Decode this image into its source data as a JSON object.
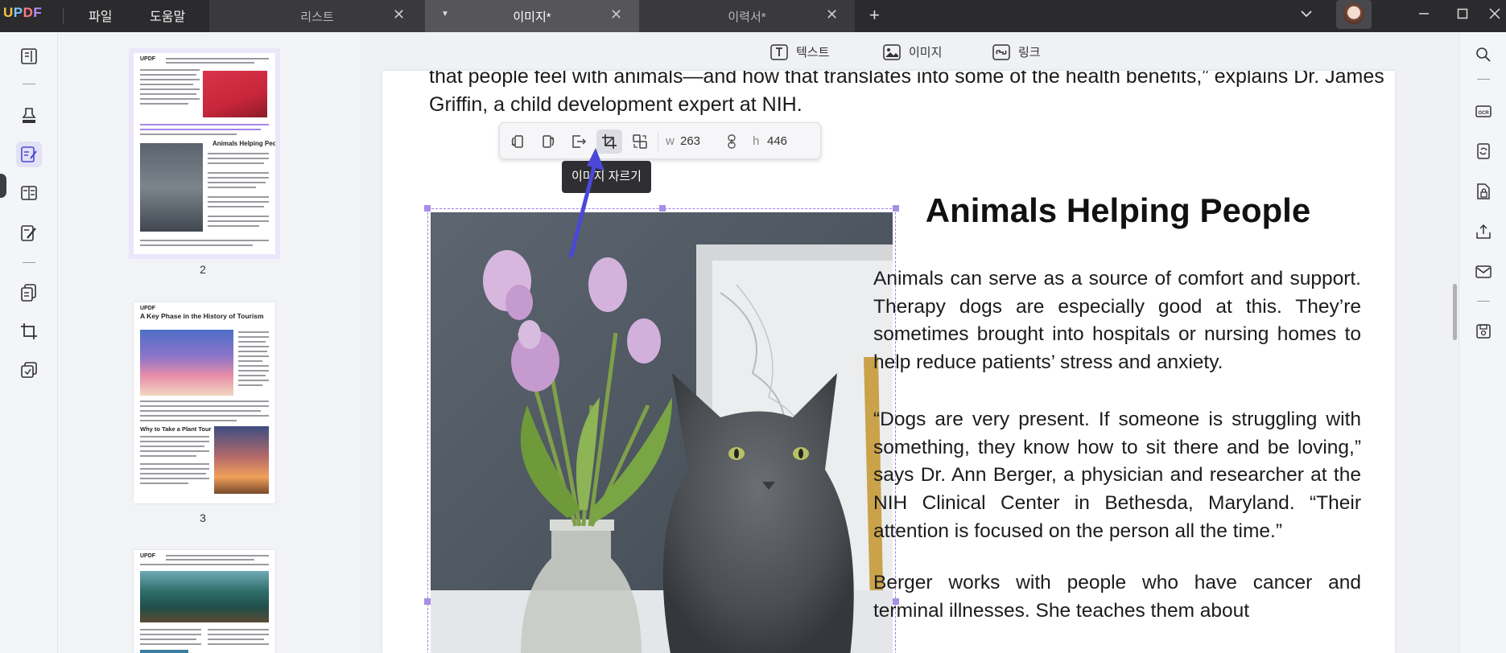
{
  "app": {
    "logo": "UPDF",
    "menu": [
      "파일",
      "도움말"
    ]
  },
  "tabs": [
    {
      "label": "리스트",
      "active": false
    },
    {
      "label": "이미지*",
      "active": true
    },
    {
      "label": "이력서*",
      "active": false
    }
  ],
  "edit_toolbar": {
    "text_label": "텍스트",
    "image_label": "이미지",
    "link_label": "링크"
  },
  "image_toolbar": {
    "width_label": "w",
    "width_value": "263",
    "height_label": "h",
    "height_value": "446",
    "tooltip": "이미지 자르기"
  },
  "thumbnails": {
    "page_numbers": [
      "2",
      "3"
    ],
    "page2_heading": "Animals Helping People",
    "page3_heading": "A Key Phase in the History of Tourism",
    "page3_subheading": "Why to Take a Plant Tour",
    "logo": "UPDF"
  },
  "document": {
    "intro": "that people feel with animals—and how that translates into some of the health benefits,” explains Dr. James Griffin, a child development expert at NIH.",
    "title": "Animals Helping People",
    "paragraphs": [
      "Animals can serve as a source of comfort and support. Therapy dogs are especially good at this. They’re sometimes brought into hospitals or nursing homes to help reduce patients’ stress and anxiety.",
      "“Dogs are very present. If someone is struggling with something, they know how to sit there and be loving,” says Dr. Ann Berger, a physician and researcher at the NIH Clinical Center in Bethesda, Maryland. “Their attention is focused on the person all the time.”",
      "Berger works with people who have cancer and terminal illnesses. She teaches them about"
    ]
  },
  "colors": {
    "titlebar": "#2b2b2e",
    "active_tab": "#55555a",
    "accent": "#8b6ee0",
    "tooltip": "#2f2f33"
  }
}
